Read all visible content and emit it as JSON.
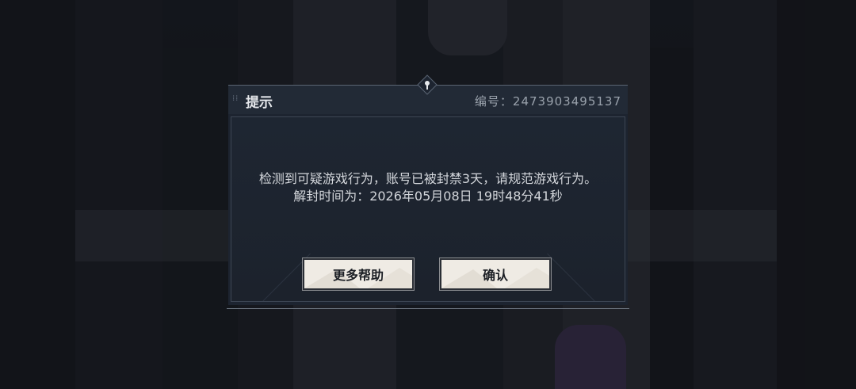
{
  "dialog": {
    "title": "提示",
    "id_text": "编号：2473903495137",
    "message_line1": "检测到可疑游戏行为，账号已被封禁3天，请规范游戏行为。",
    "message_line2": "解封时间为：2026年05月08日 19时48分41秒"
  },
  "buttons": {
    "help_label": "更多帮助",
    "confirm_label": "确认"
  },
  "colors": {
    "dialog_bg": "#1d2430",
    "button_bg": "#efebe4",
    "text_primary": "#d4d7dc"
  },
  "icons": {
    "drag_grip": "drag-grip-icon",
    "top_ornament": "diamond-ornament-icon"
  }
}
